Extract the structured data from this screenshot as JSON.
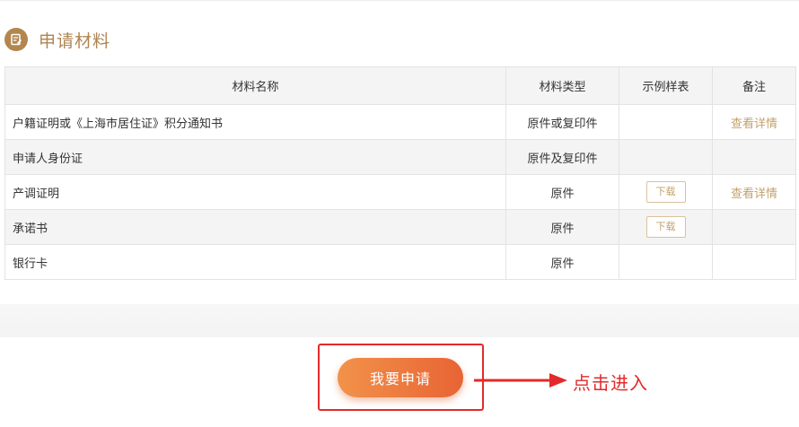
{
  "section": {
    "title": "申请材料",
    "icon": "document-edit-icon"
  },
  "table": {
    "headers": [
      "材料名称",
      "材料类型",
      "示例样表",
      "备注"
    ],
    "rows": [
      {
        "name": "户籍证明或《上海市居住证》积分通知书",
        "type": "原件或复印件",
        "sample": "",
        "remark": "查看详情"
      },
      {
        "name": "申请人身份证",
        "type": "原件及复印件",
        "sample": "",
        "remark": ""
      },
      {
        "name": "产调证明",
        "type": "原件",
        "sample": "下载",
        "remark": "查看详情"
      },
      {
        "name": "承诺书",
        "type": "原件",
        "sample": "下载",
        "remark": ""
      },
      {
        "name": "银行卡",
        "type": "原件",
        "sample": "",
        "remark": ""
      }
    ]
  },
  "apply_button": {
    "label": "我要申请"
  },
  "annotation": {
    "label": "点击进入"
  },
  "colors": {
    "accent_gold": "#b08450",
    "link_gold": "#c3a16b",
    "button_orange": "#e86434",
    "annotation_red": "#e32a2a"
  }
}
